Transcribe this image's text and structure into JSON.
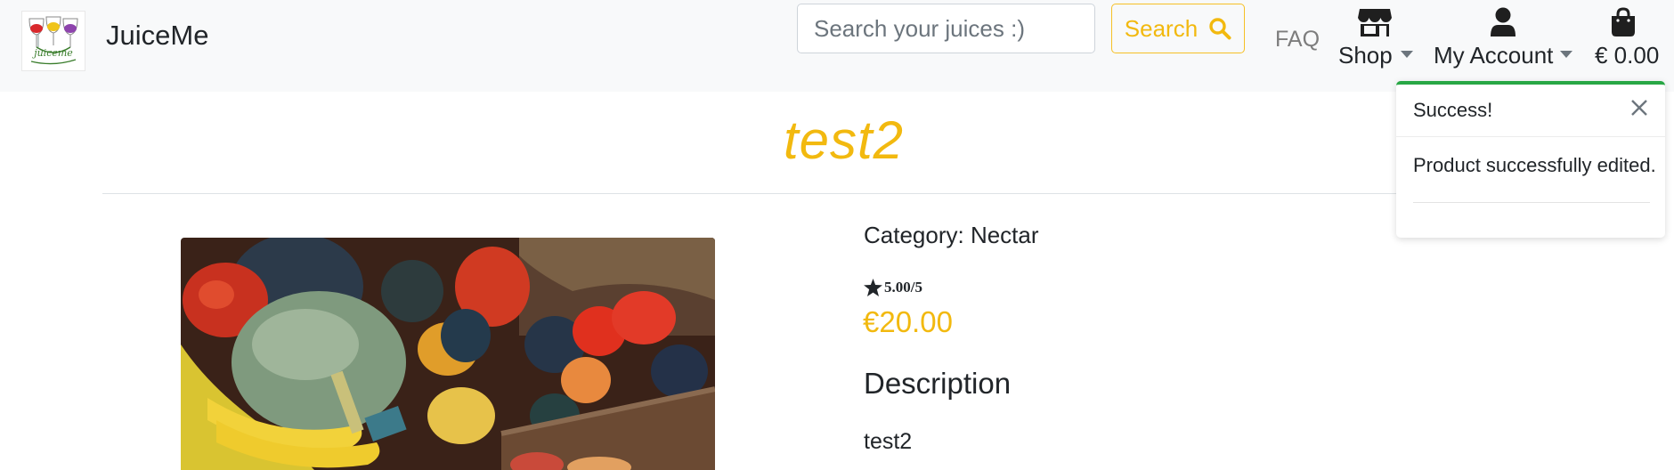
{
  "header": {
    "brand": "JuiceMe",
    "search": {
      "placeholder": "Search your juices :)",
      "value": "",
      "button_label": "Search"
    },
    "nav": {
      "faq": "FAQ",
      "shop": "Shop",
      "account": "My Account",
      "cart_total": "€ 0.00"
    }
  },
  "product": {
    "title": "test2",
    "category": "Category: Nectar",
    "rating": "5.00/5",
    "price": "€20.00",
    "description_heading": "Description",
    "description": "test2"
  },
  "toast": {
    "title": "Success!",
    "message": "Product successfully edited."
  },
  "colors": {
    "accent": "#f2b90f",
    "success": "#28a745",
    "navbar_bg": "#f8f9fa"
  }
}
